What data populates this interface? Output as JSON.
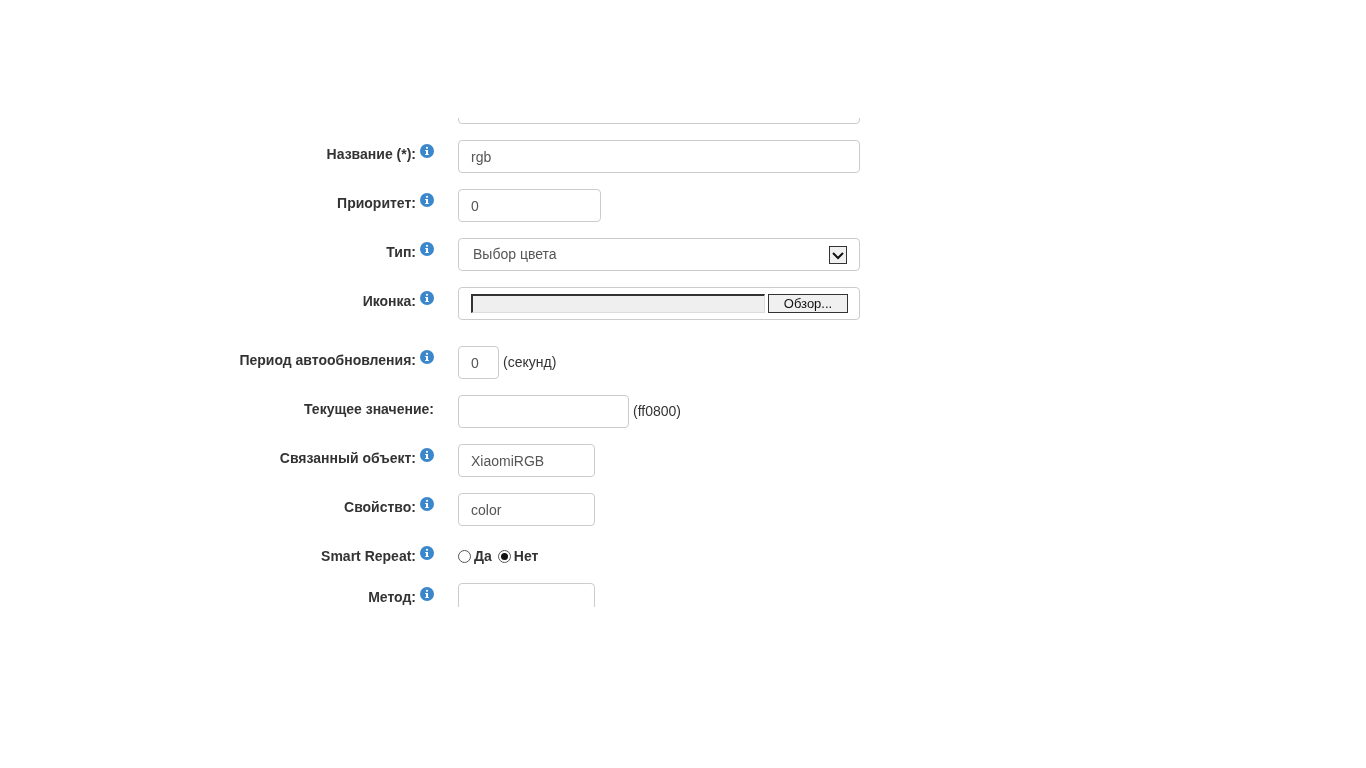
{
  "form": {
    "rows": [
      {
        "kind": "text"
      },
      {
        "kind": "text",
        "label": "Название (*):",
        "info": true,
        "value": "rgb"
      },
      {
        "kind": "text",
        "label": "Приоритет:",
        "info": true,
        "value": "0"
      },
      {
        "kind": "select",
        "label": "Тип:",
        "info": true,
        "value": "Выбор цвета"
      },
      {
        "kind": "file",
        "label": "Иконка:",
        "info": true,
        "button": "Обзор..."
      },
      {
        "kind": "text",
        "label": "Период автообновления:",
        "info": true,
        "value": "0",
        "suffix": "(секунд)"
      },
      {
        "kind": "text",
        "label": "Текущее значение:",
        "info": false,
        "suffix": "(ff0800)"
      },
      {
        "kind": "text",
        "label": "Связанный объект:",
        "info": true,
        "value": "XiaomiRGB"
      },
      {
        "kind": "text",
        "label": "Свойство:",
        "info": true,
        "value": "color"
      },
      {
        "kind": "radio",
        "label": "Smart Repeat:",
        "info": true,
        "options": [
          {
            "label": "Да",
            "selected": false
          },
          {
            "label": "Нет",
            "selected": true
          }
        ]
      },
      {
        "kind": "text",
        "label": "Метод:",
        "info": true
      }
    ]
  }
}
